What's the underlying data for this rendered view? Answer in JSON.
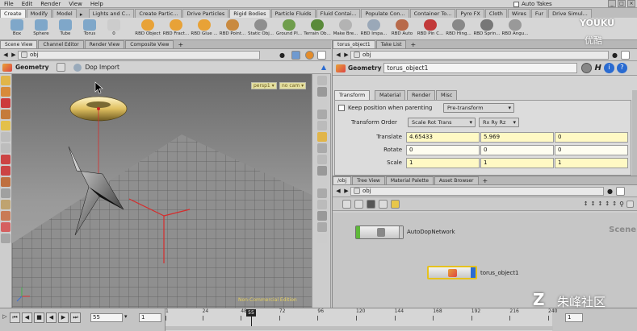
{
  "menubar": {
    "items": [
      "File",
      "Edit",
      "Render",
      "View",
      "Help"
    ],
    "take_label": "Auto Takes",
    "win_controls": [
      "_",
      "□",
      "×"
    ]
  },
  "shelf_tabs": {
    "left": [
      "Create",
      "Modify",
      "Model"
    ],
    "right": [
      "Lights and C...",
      "Create Partic...",
      "Drive Particles",
      "Rigid Bodies",
      "Particle Fluids",
      "Fluid Contai...",
      "Populate Con...",
      "Container To...",
      "Pyro FX",
      "Cloth",
      "Wires",
      "Fur",
      "Drive Simul..."
    ]
  },
  "shelf_tools_left": [
    {
      "label": "Box",
      "color": "#7fa7c9"
    },
    {
      "label": "Sphere",
      "color": "#7fa7c9"
    },
    {
      "label": "Tube",
      "color": "#7fa7c9"
    },
    {
      "label": "Torus",
      "color": "#7fa7c9"
    },
    {
      "label": "0",
      "color": "#cccccc"
    }
  ],
  "shelf_tools_right": [
    {
      "label": "RBD Object",
      "color": "#e8a237"
    },
    {
      "label": "RBD Fract...",
      "color": "#e8a237"
    },
    {
      "label": "RBD Glue ...",
      "color": "#e8a237"
    },
    {
      "label": "RBD Point...",
      "color": "#c98a40"
    },
    {
      "label": "Static Obj...",
      "color": "#8e8e8e"
    },
    {
      "label": "Ground Pl...",
      "color": "#6f9d4c"
    },
    {
      "label": "Terrain Ob...",
      "color": "#5a8a3a"
    },
    {
      "label": "Make Bre...",
      "color": "#b3b3b3"
    },
    {
      "label": "RBD Impa...",
      "color": "#9aa8b8"
    },
    {
      "label": "RBD Auto",
      "color": "#b86a4a"
    },
    {
      "label": "RBD Pin C...",
      "color": "#c23a3a"
    },
    {
      "label": "RBD Hing...",
      "color": "#888888"
    },
    {
      "label": "RBD Sprin...",
      "color": "#777777"
    },
    {
      "label": "RBD Angu...",
      "color": "#999999"
    }
  ],
  "left_pane": {
    "tabs": [
      "Scene View",
      "Channel Editor",
      "Render View",
      "Composite View"
    ],
    "path": "obj",
    "context": "Geometry",
    "node_label": "Dop Import",
    "persp": "persp1 ▾",
    "cam": "no cam ▾",
    "watermark": "Non-Commercial Edition"
  },
  "right_top": {
    "tabs": [
      "torus_object1",
      "Take List"
    ],
    "path": "obj",
    "context": "Geometry",
    "node_name": "torus_object1",
    "param_tabs": [
      "Transform",
      "Material",
      "Render",
      "Misc"
    ],
    "keep_position": "Keep position when parenting",
    "keep_position_value": "Pre-transform",
    "transform_order_label": "Transform Order",
    "transform_order": "Scale Rot Trans",
    "rot_order": "Rx Ry Rz",
    "rows": [
      {
        "label": "Translate",
        "values": [
          "4.65433",
          "5.969",
          "0"
        ],
        "hl": true
      },
      {
        "label": "Rotate",
        "values": [
          "0",
          "0",
          "0"
        ],
        "hl": false
      },
      {
        "label": "Scale",
        "values": [
          "1",
          "1",
          "1"
        ],
        "hl": true
      }
    ]
  },
  "right_bottom": {
    "tabs": [
      "/obj",
      "Tree View",
      "Material Palette",
      "Asset Browser"
    ],
    "path": "obj",
    "scene_label": "Scene",
    "nodes": [
      "AutoDopNetwork",
      "torus_object1"
    ]
  },
  "timeline": {
    "frame": "55",
    "start": "1",
    "current": "55",
    "ticks": [
      "1",
      "24",
      "48",
      "72",
      "96",
      "120",
      "144",
      "168",
      "192",
      "216",
      "240"
    ],
    "end": "1"
  },
  "watermarks": {
    "youku": "YOUKU",
    "youku_cn": "优酷",
    "zhufeng": "朱峰社区"
  },
  "colors": {
    "accent_blue": "#2a6bd1",
    "node_selected": "#e6c21d",
    "origin_red": "#d62c2c"
  }
}
